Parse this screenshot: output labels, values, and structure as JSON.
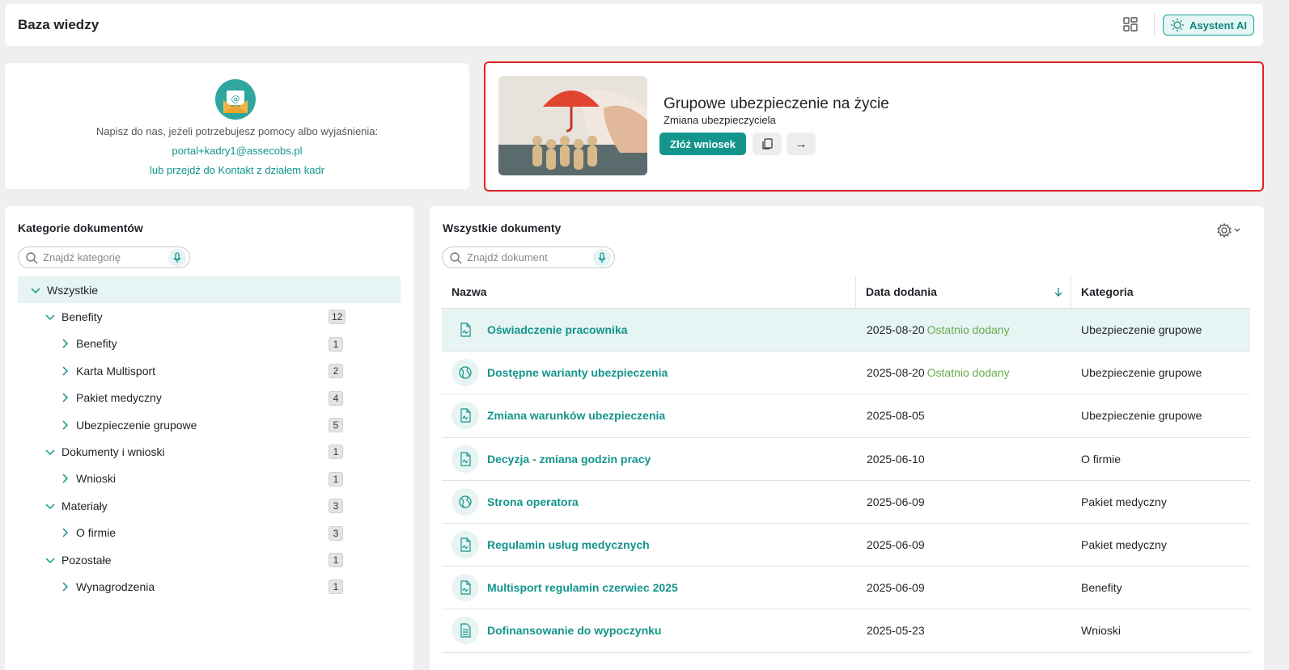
{
  "header": {
    "title": "Baza wiedzy",
    "ai_button": "Asystent AI"
  },
  "contact": {
    "help_text": "Napisz do nas, jeżeli potrzebujesz pomocy albo wyjaśnienia:",
    "email": "portal+kadry1@assecobs.pl",
    "kontakt_link": "lub przejdź do Kontakt z działem kadr"
  },
  "feature": {
    "title": "Grupowe ubezpieczenie na życie",
    "subtitle": "Zmiana ubezpieczyciela",
    "apply_button": "Złóż wniosek",
    "next_arrow": "→"
  },
  "categories": {
    "title": "Kategorie dokumentów",
    "search_placeholder": "Znajdź kategorię",
    "items": [
      {
        "label": "Wszystkie",
        "level": 0,
        "expanded": true,
        "count": ""
      },
      {
        "label": "Benefity",
        "level": 1,
        "expanded": true,
        "count": "12"
      },
      {
        "label": "Benefity",
        "level": 2,
        "expanded": false,
        "count": "1"
      },
      {
        "label": "Karta Multisport",
        "level": 2,
        "expanded": false,
        "count": "2"
      },
      {
        "label": "Pakiet medyczny",
        "level": 2,
        "expanded": false,
        "count": "4"
      },
      {
        "label": "Ubezpieczenie grupowe",
        "level": 2,
        "expanded": false,
        "count": "5"
      },
      {
        "label": "Dokumenty i wnioski",
        "level": 1,
        "expanded": true,
        "count": "1"
      },
      {
        "label": "Wnioski",
        "level": 2,
        "expanded": false,
        "count": "1"
      },
      {
        "label": "Materiały",
        "level": 1,
        "expanded": true,
        "count": "3"
      },
      {
        "label": "O firmie",
        "level": 2,
        "expanded": false,
        "count": "3"
      },
      {
        "label": "Pozostałe",
        "level": 1,
        "expanded": true,
        "count": "1"
      },
      {
        "label": "Wynagrodzenia",
        "level": 2,
        "expanded": false,
        "count": "1"
      }
    ]
  },
  "documents": {
    "title": "Wszystkie dokumenty",
    "search_placeholder": "Znajdź dokument",
    "columns": {
      "name": "Nazwa",
      "date": "Data dodania",
      "category": "Kategoria"
    },
    "rows": [
      {
        "name": "Oświadczenie pracownika",
        "date": "2025-08-20",
        "badge": "Ostatnio dodany",
        "category": "Ubezpieczenie grupowe",
        "icon": "pdf-document-icon"
      },
      {
        "name": "Dostępne warianty ubezpieczenia",
        "date": "2025-08-20",
        "badge": "Ostatnio dodany",
        "category": "Ubezpieczenie grupowe",
        "icon": "globe-link-icon"
      },
      {
        "name": "Zmiana warunków ubezpieczenia",
        "date": "2025-08-05",
        "badge": "",
        "category": "Ubezpieczenie grupowe",
        "icon": "pdf-document-icon"
      },
      {
        "name": "Decyzja - zmiana godzin pracy",
        "date": "2025-06-10",
        "badge": "",
        "category": "O firmie",
        "icon": "pdf-document-icon"
      },
      {
        "name": "Strona operatora",
        "date": "2025-06-09",
        "badge": "",
        "category": "Pakiet medyczny",
        "icon": "globe-link-icon"
      },
      {
        "name": "Regulamin usług medycznych",
        "date": "2025-06-09",
        "badge": "",
        "category": "Pakiet medyczny",
        "icon": "pdf-document-icon"
      },
      {
        "name": "Multisport regulamin czerwiec 2025",
        "date": "2025-06-09",
        "badge": "",
        "category": "Benefity",
        "icon": "pdf-document-icon"
      },
      {
        "name": "Dofinansowanie do wypoczynku",
        "date": "2025-05-23",
        "badge": "",
        "category": "Wnioski",
        "icon": "text-document-icon"
      }
    ]
  },
  "colors": {
    "accent": "#13958c",
    "highlight_border": "#e02424",
    "recent_badge": "#6aab4f",
    "active_row": "#e6f4f3"
  }
}
